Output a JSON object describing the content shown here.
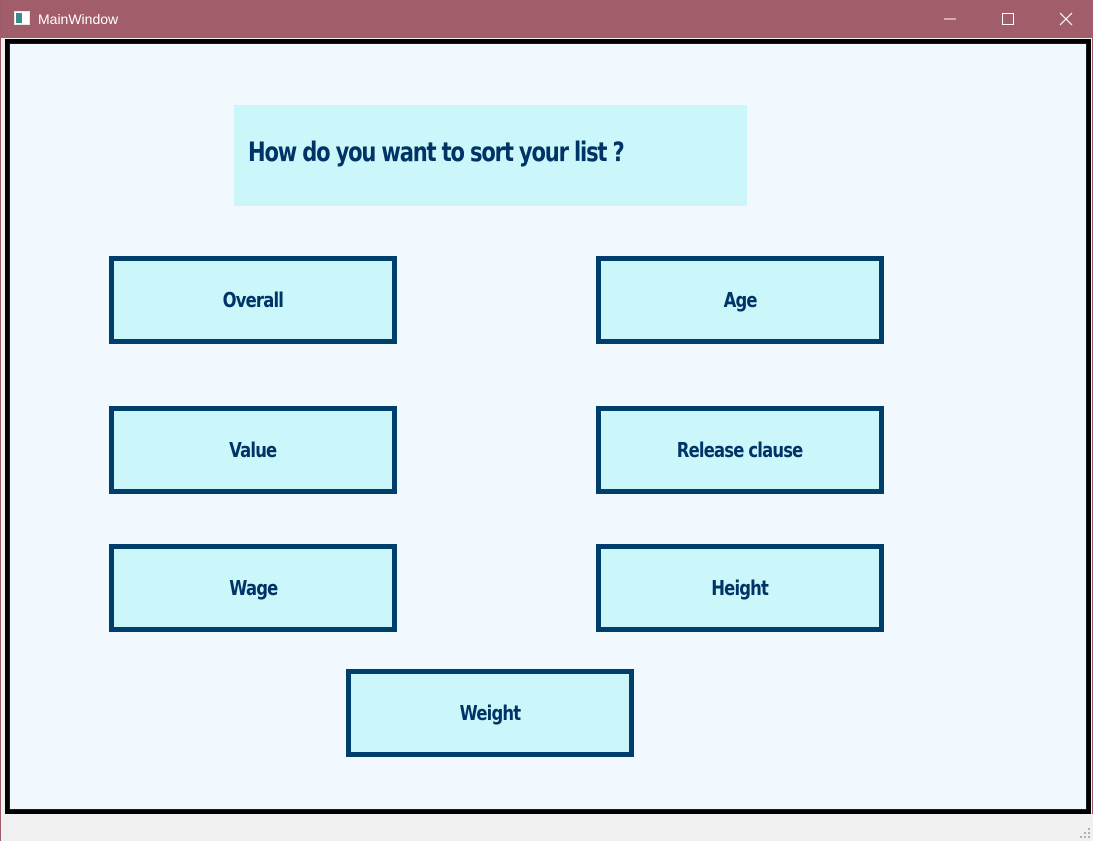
{
  "window": {
    "title": "MainWindow",
    "icon": "app-window-icon",
    "controls": [
      "minimize-icon",
      "maximize-icon",
      "close-icon"
    ],
    "titlebar_color": "#a15d69"
  },
  "main": {
    "heading": "How do you want to sort your list ?",
    "buttons": {
      "overall": "Overall",
      "age": "Age",
      "value": "Value",
      "release_clause": "Release clause",
      "wage": "Wage",
      "height": "Height",
      "weight": "Weight"
    },
    "colors": {
      "background": "#f2f9fe",
      "button_fill": "#cbf7fb",
      "button_border": "#003f6b",
      "text": "#003366"
    }
  }
}
